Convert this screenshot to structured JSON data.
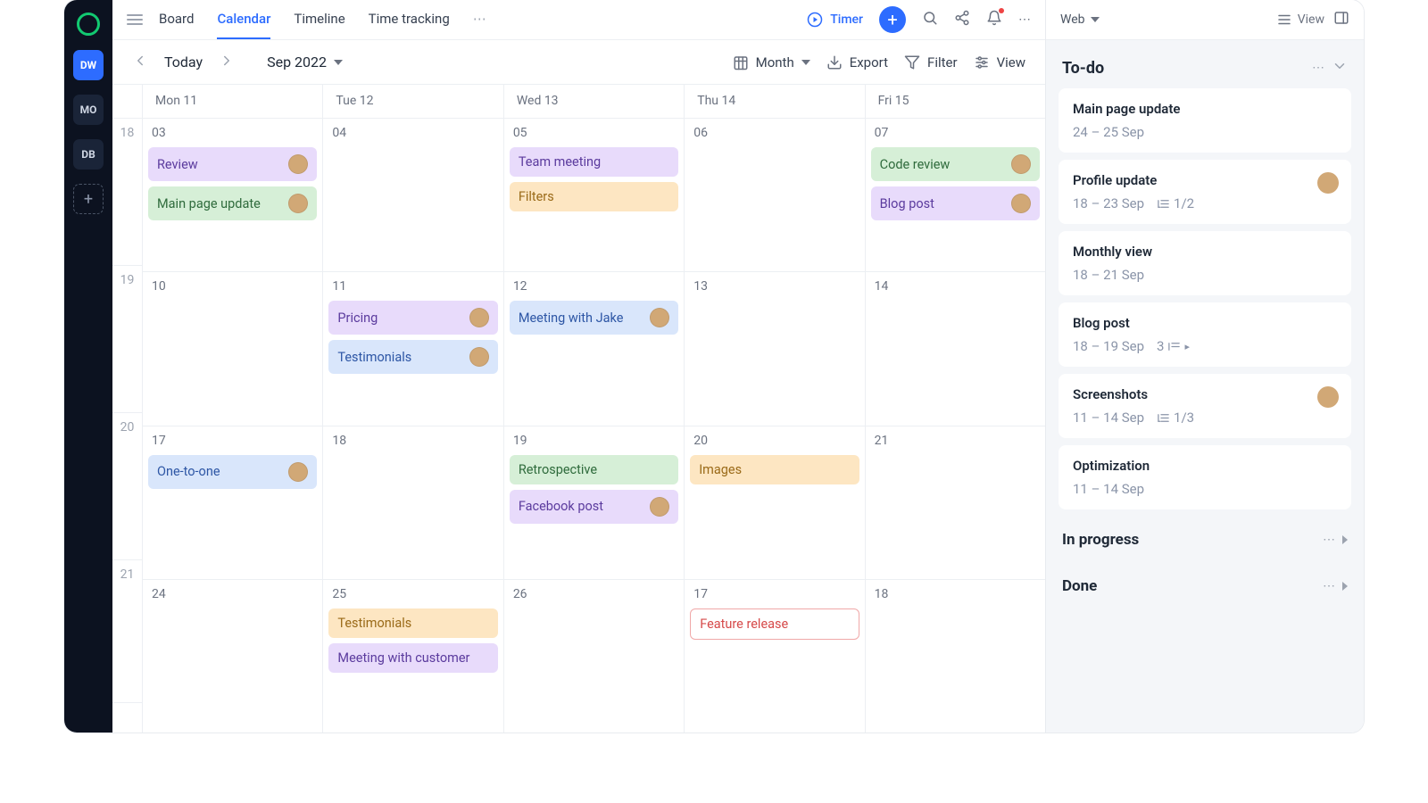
{
  "rail": {
    "workspaces": [
      "DW",
      "MO",
      "DB"
    ]
  },
  "header": {
    "tabs": [
      "Board",
      "Calendar",
      "Timeline",
      "Time tracking"
    ],
    "active_tab": "Calendar",
    "timer_label": "Timer"
  },
  "toolbar": {
    "today": "Today",
    "period": "Sep 2022",
    "mode": "Month",
    "export": "Export",
    "filter": "Filter",
    "view": "View"
  },
  "weekdays": [
    "Mon 11",
    "Tue 12",
    "Wed 13",
    "Thu 14",
    "Fri 15"
  ],
  "weeks": [
    "18",
    "19",
    "20",
    "21"
  ],
  "rows": [
    {
      "days": [
        "03",
        "04",
        "05",
        "06",
        "07"
      ],
      "cells": [
        [
          {
            "t": "Review",
            "c": "purple",
            "a": true
          },
          {
            "t": "Main page update",
            "c": "green",
            "a": true
          }
        ],
        [],
        [
          {
            "t": "Team meeting",
            "c": "purple"
          },
          {
            "t": "Filters",
            "c": "orange"
          }
        ],
        [],
        [
          {
            "t": "Code review",
            "c": "green",
            "a": true
          },
          {
            "t": "Blog post",
            "c": "purple",
            "a": true
          }
        ]
      ]
    },
    {
      "days": [
        "10",
        "11",
        "12",
        "13",
        "14"
      ],
      "cells": [
        [],
        [
          {
            "t": "Pricing",
            "c": "purple",
            "a": true
          },
          {
            "t": "Testimonials",
            "c": "blue",
            "a": true
          }
        ],
        [
          {
            "t": "Meeting with Jake",
            "c": "blue",
            "a": true
          }
        ],
        [],
        []
      ]
    },
    {
      "days": [
        "17",
        "18",
        "19",
        "20",
        "21"
      ],
      "cells": [
        [
          {
            "t": "One-to-one",
            "c": "blue",
            "a": true
          }
        ],
        [],
        [
          {
            "t": "Retrospective",
            "c": "green"
          },
          {
            "t": "Facebook post",
            "c": "purple",
            "a": true
          }
        ],
        [
          {
            "t": "Images",
            "c": "orange"
          }
        ],
        []
      ]
    },
    {
      "days": [
        "24",
        "25",
        "26",
        "17",
        "18"
      ],
      "cells": [
        [],
        [
          {
            "t": "Testimonials",
            "c": "orange"
          },
          {
            "t": "Meeting with customer",
            "c": "purple"
          }
        ],
        [],
        [
          {
            "t": "Feature release",
            "c": "red"
          }
        ],
        []
      ]
    }
  ],
  "sidebar": {
    "board": "Web",
    "view_label": "View",
    "sections": {
      "todo": {
        "title": "To-do",
        "cards": [
          {
            "title": "Main page update",
            "date": "24 – 25 Sep"
          },
          {
            "title": "Profile update",
            "date": "18 – 23 Sep",
            "sub": "1/2",
            "av": true
          },
          {
            "title": "Monthly view",
            "date": "18 – 21 Sep"
          },
          {
            "title": "Blog post",
            "date": "18 – 19 Sep",
            "extra": "3"
          },
          {
            "title": "Screenshots",
            "date": "11 – 14 Sep",
            "sub": "1/3",
            "av": true
          },
          {
            "title": "Optimization",
            "date": "11 – 14 Sep"
          }
        ]
      },
      "inprogress": {
        "title": "In progress"
      },
      "done": {
        "title": "Done"
      }
    }
  }
}
